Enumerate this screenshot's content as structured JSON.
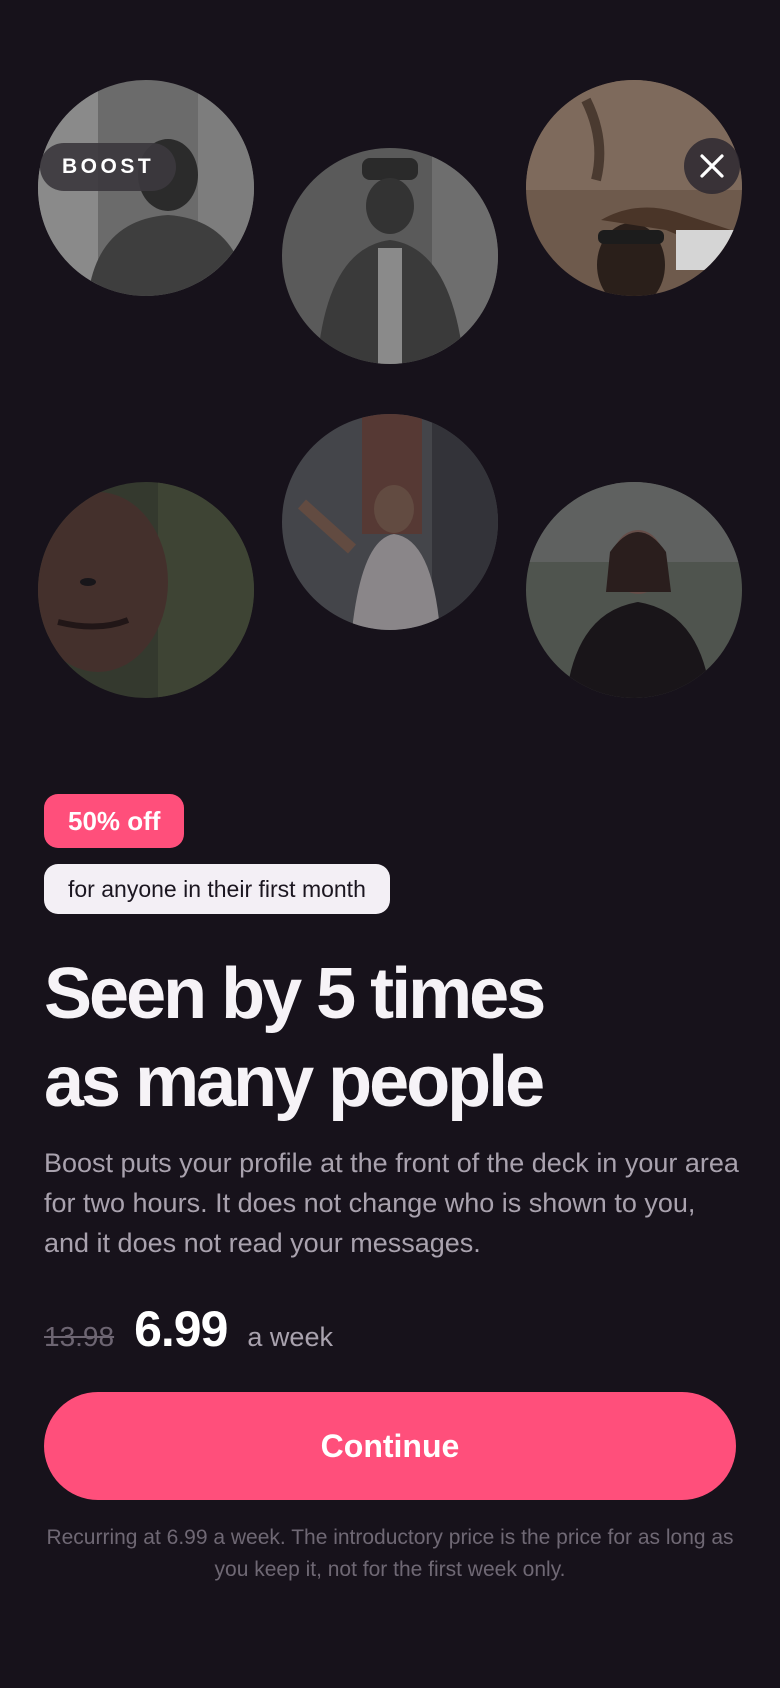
{
  "header": {
    "tag_label": "BOOST",
    "close_icon": "close-icon"
  },
  "photos": [
    {
      "name": "profile-photo-1",
      "desc_icon": "person-photo"
    },
    {
      "name": "profile-photo-2",
      "desc_icon": "person-photo"
    },
    {
      "name": "profile-photo-3",
      "desc_icon": "person-photo"
    },
    {
      "name": "profile-photo-4",
      "desc_icon": "person-photo"
    },
    {
      "name": "profile-photo-5",
      "desc_icon": "person-photo"
    },
    {
      "name": "profile-photo-6",
      "desc_icon": "person-photo"
    }
  ],
  "offer": {
    "discount_label": "50% off",
    "eligibility_label": "for anyone in their first month"
  },
  "headline": {
    "line1": "Seen by 5 times",
    "line2": "as many people"
  },
  "description": "Boost puts your profile at the front of the deck in your area for two hours. It does not change who is shown to you, and it does not read your messages.",
  "pricing": {
    "old_price": "13.98",
    "new_price": "6.99",
    "period": "a week"
  },
  "cta": {
    "continue_label": "Continue"
  },
  "fine_print": "Recurring at 6.99 a week. The introductory price is the price for as long as you keep it, not for the first week only.",
  "colors": {
    "background": "#17121b",
    "accent": "#ff4f7b",
    "text_primary": "#f6f3f7",
    "text_secondary": "#a9a2ae"
  }
}
